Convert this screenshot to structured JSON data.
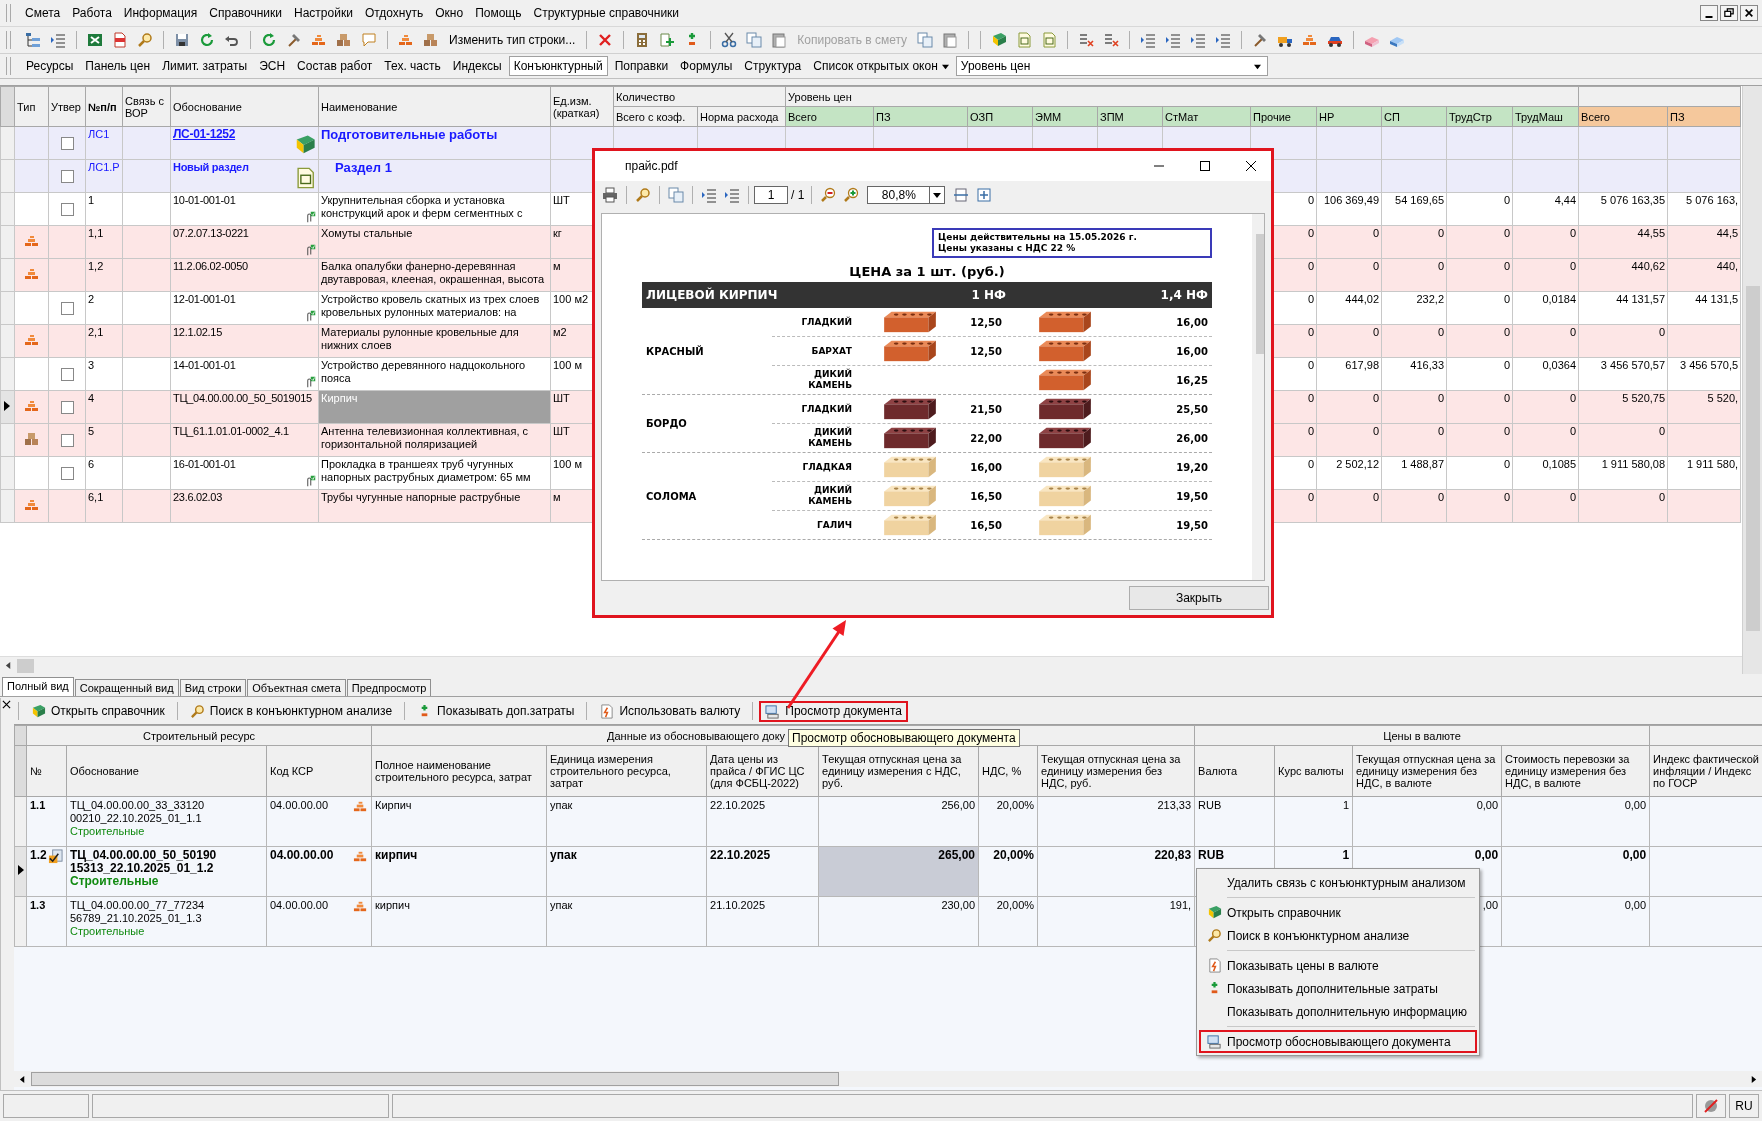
{
  "menu": [
    "Смета",
    "Работа",
    "Информация",
    "Справочники",
    "Настройки",
    "Отдохнуть",
    "Окно",
    "Помощь",
    "Структурные справочники"
  ],
  "toolbar": {
    "buttons": [
      {
        "label": "Изменить тип строки...",
        "disabled": false
      },
      {
        "label": "Копировать в смету",
        "disabled": true
      }
    ]
  },
  "panel_bar": {
    "buttons": [
      {
        "label": "Ресурсы",
        "selected": false
      },
      {
        "label": "Панель цен",
        "selected": false
      },
      {
        "label": "Лимит. затраты",
        "selected": false
      },
      {
        "label": "ЭСН",
        "selected": false
      },
      {
        "label": "Состав работ",
        "selected": false
      },
      {
        "label": "Тех. часть",
        "selected": false
      },
      {
        "label": "Индексы",
        "selected": false
      },
      {
        "label": "Конъюнктурный",
        "selected": true
      },
      {
        "label": "Поправки",
        "selected": false
      },
      {
        "label": "Формулы",
        "selected": false
      },
      {
        "label": "Структура",
        "selected": false
      }
    ],
    "dropdown": "Список открытых окон",
    "combo": "Уровень цен"
  },
  "estimate": {
    "groups": [
      "Количество",
      "Уровень цен"
    ],
    "columns": [
      {
        "label": "Тип"
      },
      {
        "label": "Утвер"
      },
      {
        "label": "№п/п"
      },
      {
        "label": "Связь с ВОР"
      },
      {
        "label": "Обоснование"
      },
      {
        "label": "Наименование"
      },
      {
        "label": "Ед.изм. (краткая)"
      },
      {
        "label": "Всего с коэф."
      },
      {
        "label": "Норма расхода"
      },
      {
        "label": "Всего",
        "color": "#c4e4c4"
      },
      {
        "label": "ПЗ",
        "color": "#c4e4c4"
      },
      {
        "label": "ОЗП",
        "color": "#c4e4c4"
      },
      {
        "label": "ЭММ",
        "color": "#c4e4c4"
      },
      {
        "label": "ЗПМ",
        "color": "#c4e4c4"
      },
      {
        "label": "СтМат",
        "color": "#c4e4c4"
      },
      {
        "label": "Прочие",
        "color": "#c4e4c4"
      },
      {
        "label": "НР",
        "color": "#c4e4c4"
      },
      {
        "label": "СП",
        "color": "#c4e4c4"
      },
      {
        "label": "ТрудСтр",
        "color": "#c4e4c4"
      },
      {
        "label": "ТрудМаш",
        "color": "#c4e4c4"
      },
      {
        "label": "Всего",
        "color": "#f5c89c"
      },
      {
        "label": "ПЗ",
        "color": "#f5c89c"
      }
    ],
    "rows": [
      {
        "kind": "estimate",
        "selected": false,
        "checked": false,
        "num": "ЛС1",
        "basis": "ЛС-01-1252",
        "name": "Подготовительные работы"
      },
      {
        "kind": "section",
        "selected": false,
        "checked": false,
        "num": "ЛС1.Р",
        "basis": "Новый раздел",
        "name": "Раздел 1"
      },
      {
        "kind": "work",
        "selected": false,
        "checked": false,
        "attached": true,
        "num": "1",
        "basis": "10-01-001-01",
        "name": "Укрупнительная сборка и установка конструкций арок и ферм сегментных с",
        "unit": "ШТ",
        "values": [
          "0",
          "106 369,49",
          "54 169,65",
          "0",
          "4,44",
          "5 076 163,35",
          "5 076 163,"
        ]
      },
      {
        "kind": "material",
        "selected": false,
        "attached": true,
        "num": "1,1",
        "basis": "07.2.07.13-0221",
        "name": "Хомуты стальные",
        "unit": "кг",
        "values": [
          "0",
          "0",
          "0",
          "0",
          "0",
          "44,55",
          "44,5"
        ]
      },
      {
        "kind": "material",
        "selected": false,
        "attached": false,
        "num": "1,2",
        "basis": "11.2.06.02-0050",
        "name": "Балка опалубки фанерно-деревянная двутавровая, клееная, окрашенная, высота",
        "unit": "м",
        "values": [
          "0",
          "0",
          "0",
          "0",
          "0",
          "440,62",
          "440,"
        ]
      },
      {
        "kind": "work",
        "selected": false,
        "checked": false,
        "attached": true,
        "num": "2",
        "basis": "12-01-001-01",
        "name": "Устройство кровель скатных из трех слоев кровельных рулонных материалов: на",
        "unit": "100 м2",
        "values": [
          "0",
          "444,02",
          "232,2",
          "0",
          "0,0184",
          "44 131,57",
          "44 131,5"
        ]
      },
      {
        "kind": "material",
        "selected": false,
        "attached": false,
        "num": "2,1",
        "basis": "12.1.02.15",
        "name": "Материалы рулонные кровельные для нижних слоев",
        "unit": "м2",
        "values": [
          "0",
          "0",
          "0",
          "0",
          "0",
          "0"
        ]
      },
      {
        "kind": "work",
        "selected": false,
        "checked": false,
        "attached": true,
        "num": "3",
        "basis": "14-01-001-01",
        "name": "Устройство деревянного надцокольного пояса",
        "unit": "100 м",
        "values": [
          "0",
          "617,98",
          "416,33",
          "0",
          "0,0364",
          "3 456 570,57",
          "3 456 570,5"
        ]
      },
      {
        "kind": "material",
        "selected": true,
        "checked": false,
        "attached": false,
        "num": "4",
        "basis": "ТЦ_04.00.00.00_50_5019015",
        "name": "Кирпич",
        "unit": "ШТ",
        "values": [
          "0",
          "0",
          "0",
          "0",
          "0",
          "5 520,75",
          "5 520,"
        ]
      },
      {
        "kind": "equipment",
        "selected": false,
        "checked": false,
        "attached": false,
        "num": "5",
        "basis": "ТЦ_61.1.01.01-0002_4.1",
        "name": "Антенна телевизионная коллективная, с горизонтальной поляризацией",
        "unit": "ШТ",
        "values": [
          "0",
          "0",
          "0",
          "0",
          "0",
          "0"
        ]
      },
      {
        "kind": "work",
        "selected": false,
        "checked": false,
        "attached": true,
        "num": "6",
        "basis": "16-01-001-01",
        "name": "Прокладка в траншеях труб чугунных напорных раструбных диаметром: 65 мм",
        "unit": "100 м",
        "values": [
          "0",
          "2 502,12",
          "1 488,87",
          "0",
          "0,1085",
          "1 911 580,08",
          "1 911 580,"
        ]
      },
      {
        "kind": "material",
        "selected": false,
        "attached": false,
        "num": "6,1",
        "basis": "23.6.02.03",
        "name": "Трубы чугунные напорные раструбные",
        "unit": "м",
        "values": [
          "0",
          "0",
          "0",
          "0",
          "0",
          "0"
        ]
      }
    ]
  },
  "view_tabs": [
    {
      "label": "Полный вид",
      "selected": true
    },
    {
      "label": "Сокращенный вид",
      "selected": false
    },
    {
      "label": "Вид строки",
      "selected": false
    },
    {
      "label": "Объектная смета",
      "selected": false
    },
    {
      "label": "Предпросмотр",
      "selected": false
    }
  ],
  "resource_toolbar": [
    {
      "label": "Открыть справочник",
      "highlighted": false
    },
    {
      "label": "Поиск в конъюнктурном анализе",
      "highlighted": false
    },
    {
      "label": "Показывать доп.затраты",
      "highlighted": false
    },
    {
      "label": "Использовать валюту",
      "highlighted": false
    },
    {
      "label": "Просмотр документа",
      "highlighted": true
    }
  ],
  "tooltip": "Просмотр обосновывающего документа",
  "resources": {
    "groups": [
      "Строительный ресурс",
      "Данные из обосновывающего доку",
      "Цены в валюте"
    ],
    "columns": [
      "№",
      "Обоснование",
      "Код КСР",
      "Полное наименование строительного ресурса, затрат",
      "Единица измерения строительного ресурса, затрат",
      "Дата цены из прайса / ФГИС ЦС (для ФСБЦ-2022)",
      "Текущая отпускная цена за единицу измерения с НДС, руб.",
      "НДС, %",
      "Текущая отпускная цена за единицу измерения без НДС, руб.",
      "Валюта",
      "Курс валюты",
      "Текущая отпускная цена за единицу измерения без НДС, в валюте",
      "Стоимость перевозки за единицу измерения без НДС, в валюте",
      "Индекс фактической инфляции /  Индекс по  ГОСР"
    ],
    "rows": [
      {
        "selected": false,
        "checked": false,
        "num": "1.1",
        "basis_lines": [
          "ТЦ_04.00.00.00_33_33120",
          "00210_22.10.2025_01_1.1"
        ],
        "category": "Строительные",
        "code": "04.00.00.00",
        "name": "Кирпич",
        "unit": "упак",
        "date": "22.10.2025",
        "price_vat": "256,00",
        "vat": "20,00%",
        "price": "213,33",
        "currency": "RUB",
        "rate": "1",
        "price_cur": "0,00",
        "transport": "0,00"
      },
      {
        "selected": true,
        "checked": true,
        "num": "1.2",
        "basis_lines": [
          "ТЦ_04.00.00.00_50_50190",
          "15313_22.10.2025_01_1.2"
        ],
        "category": "Строительные",
        "code": "04.00.00.00",
        "name": "кирпич",
        "unit": "упак",
        "date": "22.10.2025",
        "price_vat": "265,00",
        "vat": "20,00%",
        "price": "220,83",
        "currency": "RUB",
        "rate": "1",
        "price_cur": "0,00",
        "transport": "0,00"
      },
      {
        "selected": false,
        "checked": false,
        "num": "1.3",
        "basis_lines": [
          "ТЦ_04.00.00.00_77_77234",
          "56789_21.10.2025_01_1.3"
        ],
        "category": "Строительные",
        "code": "04.00.00.00",
        "name": "кирпич",
        "unit": "упак",
        "date": "21.10.2025",
        "price_vat": "230,00",
        "vat": "20,00%",
        "price": "191,",
        "price_cur": ",00",
        "transport": "0,00"
      }
    ]
  },
  "context_menu": [
    {
      "label": "Удалить связь с конъюнктурным анализом",
      "separator_before": false,
      "highlighted": false
    },
    {
      "label": "Открыть справочник",
      "separator_before": true,
      "highlighted": false
    },
    {
      "label": "Поиск в конъюнктурном анализе",
      "separator_before": false,
      "highlighted": false
    },
    {
      "label": "Показывать цены в валюте",
      "separator_before": true,
      "highlighted": false
    },
    {
      "label": "Показывать дополнительные затраты",
      "separator_before": false,
      "highlighted": false
    },
    {
      "label": "Показывать дополнительную информацию",
      "separator_before": false,
      "highlighted": false
    },
    {
      "label": "Просмотр обосновывающего документа",
      "separator_before": true,
      "highlighted": true
    }
  ],
  "pdf_window": {
    "title": "прайс.pdf",
    "page": "1",
    "pages": "/ 1",
    "zoom": "80,8%",
    "close_button": "Закрыть",
    "notice": [
      "Цены действительны на 15.05.2026 г.",
      "Цены указаны с НДС 22 %"
    ],
    "heading": "ЦЕНА за 1 шт. (руб.)",
    "columns": [
      "ЛИЦЕВОЙ КИРПИЧ",
      "1 НФ",
      "1,4 НФ"
    ],
    "groups": [
      {
        "name": "КРАСНЫЙ",
        "items": [
          {
            "finish": "ГЛАДКИЙ",
            "nf1": "12,50",
            "nf14": "16,00"
          },
          {
            "finish": "БАРХАТ",
            "nf1": "12,50",
            "nf14": "16,00"
          },
          {
            "finish": "ДИКИЙ КАМЕНЬ",
            "nf14": "16,25"
          }
        ]
      },
      {
        "name": "БОРДО",
        "items": [
          {
            "finish": "ГЛАДКИЙ",
            "nf1": "21,50",
            "nf14": "25,50"
          },
          {
            "finish": "ДИКИЙ КАМЕНЬ",
            "nf1": "22,00",
            "nf14": "26,00"
          }
        ]
      },
      {
        "name": "СОЛОМА",
        "items": [
          {
            "finish": "ГЛАДКАЯ",
            "nf1": "16,00",
            "nf14": "19,20"
          },
          {
            "finish": "ДИКИЙ КАМЕНЬ",
            "nf1": "16,50",
            "nf14": "19,50"
          },
          {
            "finish": "ГАЛИЧ",
            "nf1": "16,50",
            "nf14": "19,50"
          }
        ]
      }
    ]
  },
  "status_bar": {
    "language": "RU"
  }
}
